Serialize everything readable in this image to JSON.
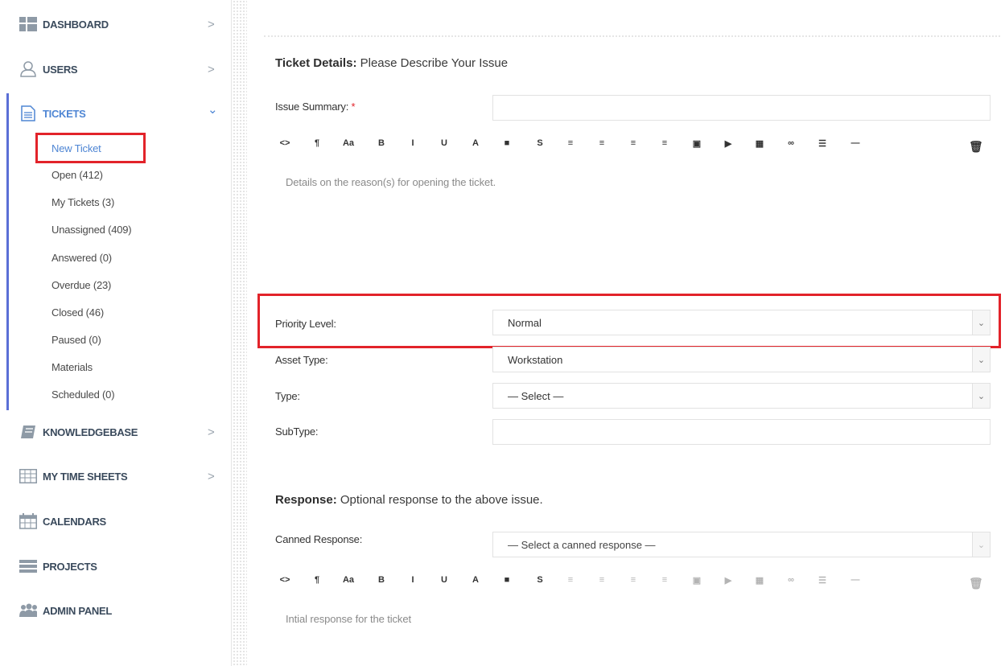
{
  "sidebar": {
    "items": [
      {
        "label": "DASHBOARD",
        "icon": "dashboard-icon",
        "chevron": ">"
      },
      {
        "label": "USERS",
        "icon": "user-icon",
        "chevron": ">"
      },
      {
        "label": "TICKETS",
        "icon": "ticket-icon",
        "chevron": "⌄"
      },
      {
        "label": "KNOWLEDGEBASE",
        "icon": "book-icon",
        "chevron": ">"
      },
      {
        "label": "MY TIME SHEETS",
        "icon": "timesheet-icon",
        "chevron": ">"
      },
      {
        "label": "CALENDARS",
        "icon": "calendar-icon"
      },
      {
        "label": "PROJECTS",
        "icon": "projects-icon"
      },
      {
        "label": "ADMIN PANEL",
        "icon": "admin-icon"
      }
    ],
    "ticket_subitems": [
      "New Ticket",
      "Open (412)",
      "My Tickets (3)",
      "Unassigned (409)",
      "Answered (0)",
      "Overdue (23)",
      "Closed (46)",
      "Paused (0)",
      "Materials",
      "Scheduled (0)"
    ]
  },
  "ticket_details": {
    "title_bold": "Ticket Details:",
    "title_rest": " Please Describe Your Issue",
    "issue_summary_label": "Issue Summary:",
    "required_mark": "*",
    "editor_placeholder": "Details on the reason(s) for opening the ticket.",
    "priority_label": "Priority Level:",
    "priority_value": "Normal",
    "asset_type_label": "Asset Type:",
    "asset_type_value": "Workstation",
    "type_label": "Type:",
    "type_value": "— Select —",
    "subtype_label": "SubType:"
  },
  "response": {
    "title_bold": "Response:",
    "title_rest": " Optional response to the above issue.",
    "canned_label": "Canned Response:",
    "canned_value": "— Select a canned response —",
    "editor_placeholder": "Intial response for the ticket"
  },
  "toolbar": {
    "buttons": [
      "<>",
      "¶",
      "Aa",
      "B",
      "I",
      "U",
      "A",
      "■",
      "S",
      "≡",
      "≡",
      "≡",
      "≡",
      "▣",
      "▶",
      "▦",
      "∞",
      "☰",
      "—"
    ],
    "delete_icon": "trash-icon"
  },
  "colors": {
    "highlight": "#e2232a",
    "active_link": "#4f86d4",
    "active_bar": "#5b6fd6"
  }
}
